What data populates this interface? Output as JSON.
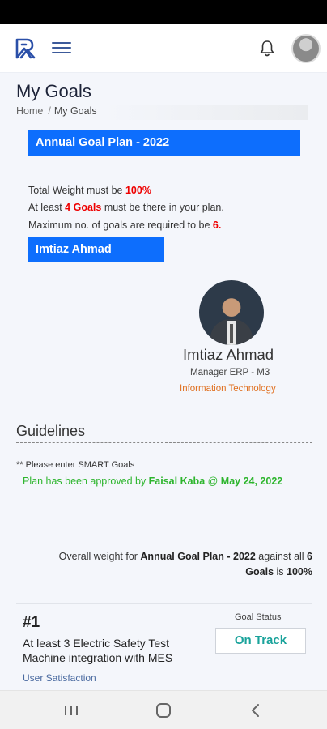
{
  "header": {
    "logo_icon": "app-logo-icon",
    "menu_icon": "hamburger-menu-icon",
    "notification_icon": "bell-icon",
    "avatar_icon": "user-avatar",
    "accent_color": "#0d6efd"
  },
  "page": {
    "title": "My Goals",
    "breadcrumb": {
      "home": "Home",
      "separator": "/",
      "current": "My Goals"
    }
  },
  "plan": {
    "banner": "Annual Goal Plan - 2022",
    "rules": {
      "weight_prefix": "Total Weight must be ",
      "weight_value": "100%",
      "min_goals_prefix": "At least ",
      "min_goals_value": "4 Goals",
      "min_goals_suffix": " must be there in your plan.",
      "max_goals_prefix": "Maximum no. of goals are required to be ",
      "max_goals_value": "6."
    },
    "employee_banner": "Imtiaz Ahmad"
  },
  "profile": {
    "name": "Imtiaz Ahmad",
    "role": "Manager ERP - M3",
    "department": "Information Technology"
  },
  "guidelines": {
    "title": "Guidelines",
    "note": "** Please enter SMART Goals",
    "approval_prefix": "Plan has been approved by ",
    "approver": "Faisal Kaba",
    "approval_at": " @ ",
    "approval_date": "May 24, 2022"
  },
  "overall": {
    "prefix": "Overall weight for ",
    "plan_name": "Annual Goal Plan - 2022",
    "middle": " against all ",
    "goal_count": "6",
    "goals_word": "Goals",
    "is_word": " is ",
    "percent": "100%"
  },
  "goals": [
    {
      "number": "#1",
      "text": "At least 3 Electric Safety Test Machine integration with MES",
      "kpi": "User Satisfaction",
      "status_label": "Goal Status",
      "status": "On Track",
      "status_color": "#1aa39b"
    }
  ],
  "navbar": {
    "recent_icon": "recent-apps-icon",
    "home_icon": "home-icon",
    "back_icon": "back-icon"
  }
}
